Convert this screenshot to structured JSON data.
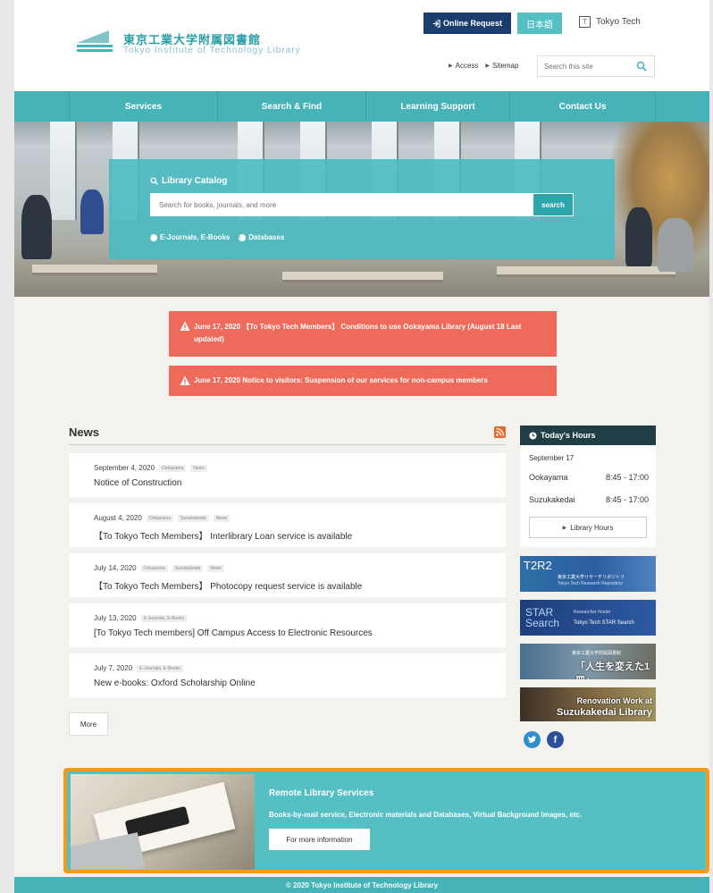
{
  "header": {
    "logo_jp": "東京工業大学附属図書館",
    "logo_en": "Tokyo Institute of Technology Library",
    "online_request": "Online Request",
    "japanese": "日本語",
    "tokyotech": "Tokyo Tech",
    "access": "Access",
    "sitemap": "Sitemap",
    "search_placeholder": "Search this site"
  },
  "nav": {
    "items": [
      {
        "label": "Services"
      },
      {
        "label": "Search & Find"
      },
      {
        "label": "Learning Support"
      },
      {
        "label": "Contact Us"
      }
    ]
  },
  "catalog": {
    "title": "Library Catalog",
    "placeholder": "Search for books, journals, and more",
    "button": "search",
    "link_ejournals": "E-Journals, E-Books",
    "link_databases": "Databases"
  },
  "alerts": [
    {
      "text": "June 17, 2020 【To Tokyo Tech Members】 Conditions to use Ookayama Library (August 18 Last updated)"
    },
    {
      "text": "June 17, 2020 Notice to visitors: Suspension of our services for non-campus members"
    }
  ],
  "news": {
    "title": "News",
    "more": "More",
    "items": [
      {
        "date": "September 4, 2020",
        "tags": [
          "Ookayama",
          "News"
        ],
        "title": "Notice of Construction"
      },
      {
        "date": "August 4, 2020",
        "tags": [
          "Ookayama",
          "Suzukakedai",
          "News"
        ],
        "title": "【To Tokyo Tech Members】 Interlibrary Loan service is available"
      },
      {
        "date": "July 14, 2020",
        "tags": [
          "Ookayama",
          "Suzukakedai",
          "News"
        ],
        "title": "【To Tokyo Tech Members】 Photocopy request service is available"
      },
      {
        "date": "July 13, 2020",
        "tags": [
          "E-Journals, E-Books"
        ],
        "title": "[To Tokyo Tech members] Off Campus Access to Electronic Resources"
      },
      {
        "date": "July 7, 2020",
        "tags": [
          "E-Journals, E-Books"
        ],
        "title": "New e-books: Oxford Scholarship Online"
      }
    ]
  },
  "hours": {
    "title": "Today's Hours",
    "date": "September 17",
    "rows": [
      {
        "campus": "Ookayama",
        "time": "8:45 - 17:00"
      },
      {
        "campus": "Suzukakedai",
        "time": "8:45 - 17:00"
      }
    ],
    "button": "Library Hours"
  },
  "banners": {
    "t2r2_big": "T2R2",
    "t2r2_jp": "東京工業大学リサーチリポジトリ",
    "t2r2_en": "Tokyo Tech Research Repository",
    "star_big1": "STAR",
    "star_big2": "Search",
    "star_small": "Researcher Finder",
    "star_name": "Tokyo Tech STAR Search",
    "book_small": "東京工業大学附属図書館",
    "book_big": "「人生を変えた1冊」",
    "suzu_line1": "Renovation Work at",
    "suzu_line2": "Suzukakedai Library"
  },
  "remote": {
    "title": "Remote Library Services",
    "desc": "Books-by-mail service, Electronic materials and Databases, Virtual Background Images, etc.",
    "button": "For more information"
  },
  "footer": {
    "copyright": "© 2020 Tokyo Institute of Technology Library"
  },
  "colors": {
    "teal": "#45b3b8",
    "navy": "#1a3d6e",
    "alert": "#ee6b5b",
    "highlight": "#f59b1a"
  }
}
